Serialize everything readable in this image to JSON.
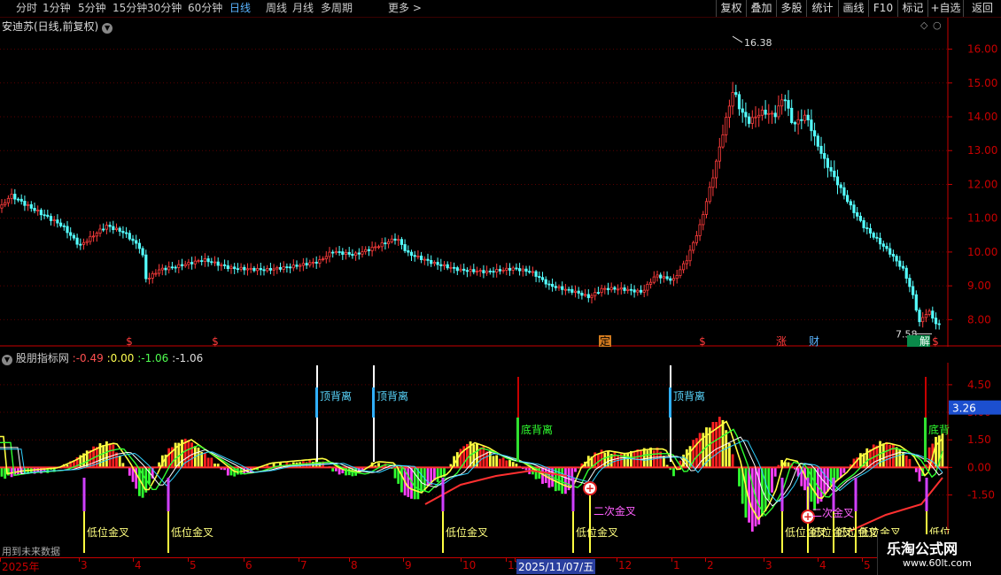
{
  "toolbar": {
    "periods": [
      "分时",
      "1分钟",
      "5分钟",
      "15分钟",
      "30分钟",
      "60分钟",
      "日线",
      "周线",
      "月线",
      "多周期"
    ],
    "active_period": "日线",
    "more_label": "更多",
    "more_arrow": ">",
    "right_buttons": [
      "复权",
      "叠加",
      "多股",
      "统计",
      "画线",
      "F10",
      "标记",
      "+自选",
      "返回"
    ]
  },
  "stock": {
    "title": "安迪苏(日线,前复权)"
  },
  "price_panel": {
    "y_ticks": [
      "16.00",
      "15.00",
      "14.00",
      "13.00",
      "12.00",
      "11.00",
      "10.00",
      "9.00",
      "8.00"
    ],
    "high_label": "16.38",
    "low_label": "7.58",
    "event_markers": [
      "$",
      "$",
      "定",
      "$",
      "涨",
      "财",
      "$"
    ],
    "unlock_label": "解"
  },
  "indicator": {
    "name": "股朋指标网",
    "values": [
      "-0.49",
      "0.00",
      "-1.06",
      "-1.06"
    ],
    "y_ticks": [
      "4.50",
      "3.00",
      "1.50",
      "0.00",
      "-1.50"
    ],
    "current_value": "3.26",
    "labels": [
      "顶背离",
      "顶背离",
      "底背离",
      "顶背离",
      "底背",
      "低位金叉",
      "低位金叉",
      "低位金叉",
      "低位金叉",
      "二次金叉",
      "低位金叉",
      "二次金叉",
      "低位金叉",
      "低位金叉",
      "低位金叉",
      "低位"
    ],
    "future_data_note": "用到未来数据"
  },
  "date_axis": {
    "labels": [
      "2025年",
      "3",
      "4",
      "5",
      "6",
      "7",
      "8",
      "9",
      "10",
      "11",
      "2025/11/07/五",
      "12",
      "1",
      "2",
      "3",
      "4",
      "5"
    ]
  },
  "watermark": {
    "title": "乐淘公式网",
    "url": "www.60lt.com"
  },
  "colors": {
    "up": "#ff3c3c",
    "down": "#54ffff",
    "bg": "#000000",
    "grid": "#5a0000",
    "axis": "#c80000",
    "active": "#5ab4ff"
  }
}
